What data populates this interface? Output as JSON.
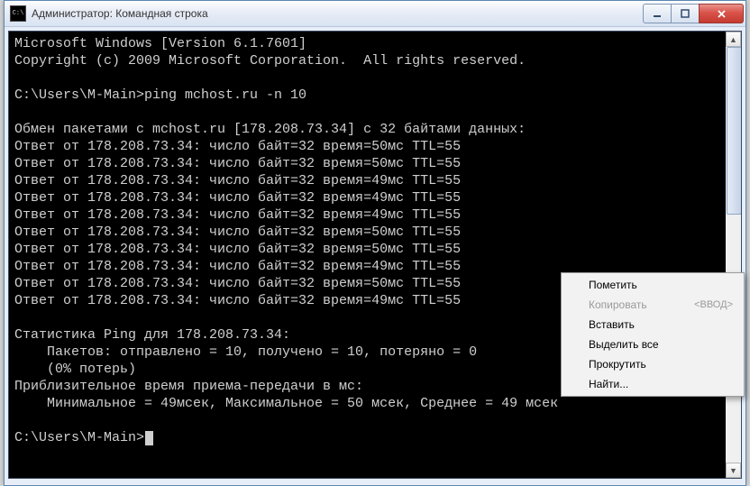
{
  "window": {
    "title": "Администратор: Командная строка"
  },
  "terminal": {
    "line_version": "Microsoft Windows [Version 6.1.7601]",
    "line_copyright": "Copyright (c) 2009 Microsoft Corporation.  All rights reserved.",
    "prompt1": "C:\\Users\\M-Main>ping mchost.ru -n 10",
    "exchange_header": "Обмен пакетами с mchost.ru [178.208.73.34] с 32 байтами данных:",
    "replies": [
      "Ответ от 178.208.73.34: число байт=32 время=50мс TTL=55",
      "Ответ от 178.208.73.34: число байт=32 время=50мс TTL=55",
      "Ответ от 178.208.73.34: число байт=32 время=49мс TTL=55",
      "Ответ от 178.208.73.34: число байт=32 время=49мс TTL=55",
      "Ответ от 178.208.73.34: число байт=32 время=49мс TTL=55",
      "Ответ от 178.208.73.34: число байт=32 время=50мс TTL=55",
      "Ответ от 178.208.73.34: число байт=32 время=50мс TTL=55",
      "Ответ от 178.208.73.34: число байт=32 время=49мс TTL=55",
      "Ответ от 178.208.73.34: число байт=32 время=50мс TTL=55",
      "Ответ от 178.208.73.34: число байт=32 время=49мс TTL=55"
    ],
    "stats_header": "Статистика Ping для 178.208.73.34:",
    "stats_packets": "    Пакетов: отправлено = 10, получено = 10, потеряно = 0",
    "stats_loss": "    (0% потерь)",
    "approx_header": "Приблизительное время приема-передачи в мс:",
    "approx_values": "    Минимальное = 49мсек, Максимальное = 50 мсек, Среднее = 49 мсек",
    "prompt2": "C:\\Users\\M-Main>"
  },
  "contextmenu": {
    "items": [
      {
        "label": "Пометить",
        "disabled": false,
        "shortcut": ""
      },
      {
        "label": "Копировать",
        "disabled": true,
        "shortcut": "<ВВОД>"
      },
      {
        "label": "Вставить",
        "disabled": false,
        "shortcut": ""
      },
      {
        "label": "Выделить все",
        "disabled": false,
        "shortcut": ""
      },
      {
        "label": "Прокрутить",
        "disabled": false,
        "shortcut": ""
      },
      {
        "label": "Найти...",
        "disabled": false,
        "shortcut": ""
      }
    ]
  }
}
